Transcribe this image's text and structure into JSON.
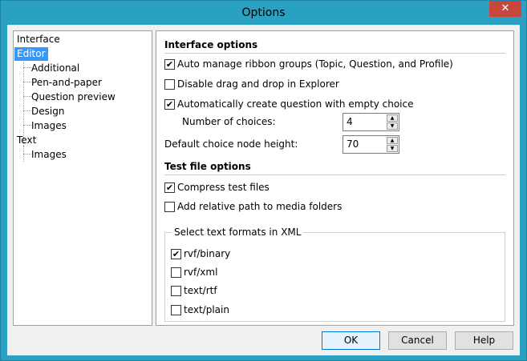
{
  "window": {
    "title": "Options",
    "close_glyph": "✕"
  },
  "tree": {
    "items": [
      {
        "label": "Interface",
        "level": 0
      },
      {
        "label": "Editor",
        "level": 0,
        "selected": true
      },
      {
        "label": "Additional",
        "level": 1
      },
      {
        "label": "Pen-and-paper",
        "level": 1
      },
      {
        "label": "Question preview",
        "level": 1
      },
      {
        "label": "Design",
        "level": 1
      },
      {
        "label": "Images",
        "level": 1
      },
      {
        "label": "Text",
        "level": 0
      },
      {
        "label": "Images",
        "level": 1
      }
    ]
  },
  "interface_options": {
    "title": "Interface options",
    "auto_manage_ribbon": {
      "label": "Auto manage ribbon groups (Topic, Question, and Profile)",
      "checked": true
    },
    "disable_drag_drop": {
      "label": "Disable drag and drop in Explorer",
      "checked": false
    },
    "auto_create_question": {
      "label": "Automatically create question with empty choice",
      "checked": true
    },
    "number_of_choices": {
      "label": "Number of choices:",
      "value": "4"
    },
    "default_node_height": {
      "label": "Default choice node height:",
      "value": "70"
    }
  },
  "test_file_options": {
    "title": "Test file options",
    "compress": {
      "label": "Compress test files",
      "checked": true
    },
    "relative_path": {
      "label": "Add relative path to media folders",
      "checked": false
    },
    "formats_group": {
      "title": "Select text formats in XML",
      "items": [
        {
          "label": "rvf/binary",
          "checked": true
        },
        {
          "label": "rvf/xml",
          "checked": false
        },
        {
          "label": "text/rtf",
          "checked": false
        },
        {
          "label": "text/plain",
          "checked": false
        }
      ]
    }
  },
  "buttons": {
    "ok": "OK",
    "cancel": "Cancel",
    "help": "Help"
  },
  "colors": {
    "titlebar": "#2aa0c2",
    "selection": "#3399ff",
    "close": "#c7473d"
  }
}
